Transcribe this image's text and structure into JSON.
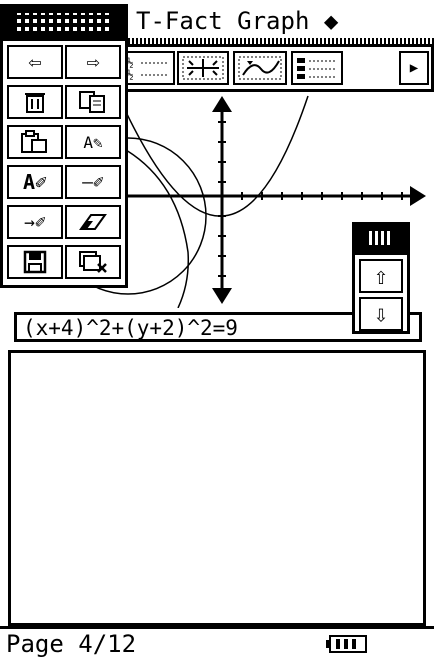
{
  "title_bar": {
    "app_title": "T-Fact Graph",
    "dropdown_glyph": "◆"
  },
  "toolbar": {
    "buttons": [
      {
        "icon": "left-arrow-icon",
        "glyph": "⇦"
      },
      {
        "icon": "right-arrow-icon",
        "glyph": "⇨"
      },
      {
        "icon": "fraction-icon",
        "glyph": ""
      },
      {
        "icon": "fit-graph-icon",
        "glyph": ""
      },
      {
        "icon": "trace-graph-icon",
        "glyph": ""
      },
      {
        "icon": "list-icon",
        "glyph": ""
      },
      {
        "icon": "scroll-right-icon",
        "glyph": "▶"
      }
    ]
  },
  "expression": "(x+4)^2+(y+2)^2=9",
  "palette": {
    "buttons": [
      {
        "name": "undo-icon",
        "glyph": "⇦"
      },
      {
        "name": "redo-icon",
        "glyph": "⇨"
      },
      {
        "name": "delete-icon",
        "glyph": "🗑"
      },
      {
        "name": "copy-icon",
        "glyph": "⧉"
      },
      {
        "name": "paste-icon",
        "glyph": "⎘"
      },
      {
        "name": "edit-text-icon",
        "glyph": "A✎"
      },
      {
        "name": "text-tool-icon",
        "glyph": "A✐"
      },
      {
        "name": "line-tool-icon",
        "glyph": "—✐"
      },
      {
        "name": "arrow-tool-icon",
        "glyph": "→✐"
      },
      {
        "name": "eraser-icon",
        "glyph": "⌫"
      },
      {
        "name": "save-icon",
        "glyph": "💾"
      },
      {
        "name": "clear-all-icon",
        "glyph": "⌧"
      }
    ]
  },
  "updown": {
    "up_glyph": "⇧",
    "down_glyph": "⇩"
  },
  "status_bar": {
    "page": "Page 4/12"
  }
}
